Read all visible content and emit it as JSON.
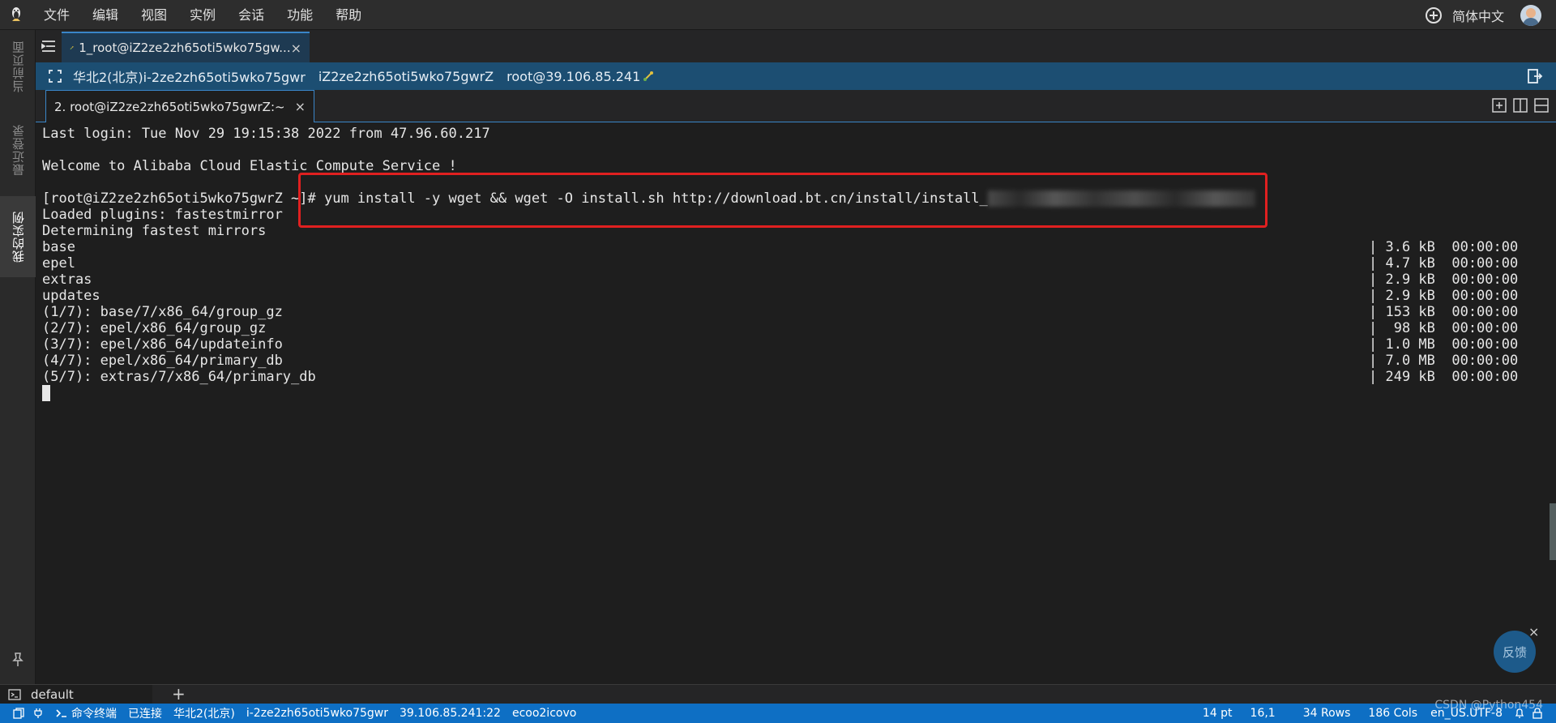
{
  "menubar": {
    "items": [
      "文件",
      "编辑",
      "视图",
      "实例",
      "会话",
      "功能",
      "帮助"
    ],
    "language": "简体中文"
  },
  "leftbar": {
    "tabs": [
      "当前页面",
      "最近登录",
      "我的实例"
    ]
  },
  "session_tab": {
    "label": "1_root@iZ2ze2zh65oti5wko75gw...",
    "close": "×"
  },
  "connection": {
    "region_instance": "华北2(北京)i-2ze2zh65oti5wko75gwr",
    "hostname": "iZ2ze2zh65oti5wko75gwrZ",
    "user_host": "root@39.106.85.241"
  },
  "terminal_tab": {
    "label": "2. root@iZ2ze2zh65oti5wko75gwrZ:~",
    "close": "×"
  },
  "terminal": {
    "line_login": "Last login: Tue Nov 29 19:15:38 2022 from 47.96.60.217",
    "line_welcome": "Welcome to Alibaba Cloud Elastic Compute Service !",
    "prompt": "[root@iZ2ze2zh65oti5wko75gwrZ ~]",
    "command": "# yum install -y wget && wget -O install.sh http://download.bt.cn/install/install_",
    "line_plugins": "Loaded plugins: fastestmirror",
    "line_mirrors": "Determining fastest mirrors",
    "repos": [
      {
        "name": "base",
        "stat": "| 3.6 kB  00:00:00"
      },
      {
        "name": "epel",
        "stat": "| 4.7 kB  00:00:00"
      },
      {
        "name": "extras",
        "stat": "| 2.9 kB  00:00:00"
      },
      {
        "name": "updates",
        "stat": "| 2.9 kB  00:00:00"
      },
      {
        "name": "(1/7): base/7/x86_64/group_gz",
        "stat": "| 153 kB  00:00:00"
      },
      {
        "name": "(2/7): epel/x86_64/group_gz",
        "stat": "|  98 kB  00:00:00"
      },
      {
        "name": "(3/7): epel/x86_64/updateinfo",
        "stat": "| 1.0 MB  00:00:00"
      },
      {
        "name": "(4/7): epel/x86_64/primary_db",
        "stat": "| 7.0 MB  00:00:00"
      },
      {
        "name": "(5/7): extras/7/x86_64/primary_db",
        "stat": "| 249 kB  00:00:00"
      }
    ]
  },
  "feedback": {
    "label": "反馈",
    "close": "×"
  },
  "profile": {
    "name": "default",
    "add": "+"
  },
  "statusbar": {
    "cmd_terminal": "命令终端",
    "connected": "已连接",
    "region_instance": "华北2(北京)",
    "instance_id": "i-2ze2zh65oti5wko75gwr",
    "address": "39.106.85.241:22",
    "user": "ecoo2icovo",
    "font_size": "14 pt",
    "cursor_pos": "16,1",
    "rows": "34 Rows",
    "cols": "186 Cols",
    "encoding": "en_US.UTF-8"
  },
  "watermark": "CSDN @Python454",
  "colors": {
    "accent": "#0e6fc4",
    "highlight": "#e02020",
    "conn_bar": "#1c4e72"
  }
}
